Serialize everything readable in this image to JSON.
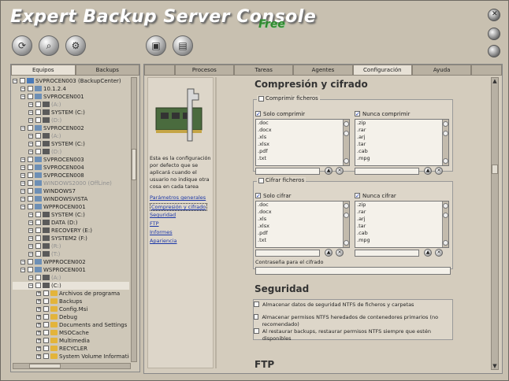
{
  "app": {
    "title": "Expert Backup Server Console",
    "edition": "Free"
  },
  "window_buttons": [
    "close",
    "minimize",
    "restore"
  ],
  "toolbar": {
    "icons": [
      "refresh-icon",
      "search-icon",
      "settings-icon",
      "save-icon",
      "database-icon"
    ]
  },
  "left_panel": {
    "tabs": [
      "Equipos",
      "Backups"
    ],
    "tree": [
      {
        "label": "SVPROCEN003 (BackupCenter)",
        "level": 0
      },
      {
        "label": "10.1.2.4",
        "level": 1
      },
      {
        "label": "SVPROCEN001",
        "level": 1
      },
      {
        "label": "(A:)",
        "level": 2,
        "disabled": true
      },
      {
        "label": "SYSTEM (C:)",
        "level": 2
      },
      {
        "label": "(D:)",
        "level": 2,
        "disabled": true
      },
      {
        "label": "SVPROCEN002",
        "level": 1
      },
      {
        "label": "(A:)",
        "level": 2,
        "disabled": true
      },
      {
        "label": "SYSTEM (C:)",
        "level": 2
      },
      {
        "label": "(D:)",
        "level": 2,
        "disabled": true
      },
      {
        "label": "SVPROCEN003",
        "level": 1
      },
      {
        "label": "SVPROCEN004",
        "level": 1
      },
      {
        "label": "SVPROCEN008",
        "level": 1
      },
      {
        "label": "WINDOWS2000 (OffLine)",
        "level": 1,
        "disabled": true
      },
      {
        "label": "WINDOWS7",
        "level": 1
      },
      {
        "label": "WINDOWSVISTA",
        "level": 1
      },
      {
        "label": "WPPROCEN001",
        "level": 1
      },
      {
        "label": "SYSTEM (C:)",
        "level": 2
      },
      {
        "label": "DATA (D:)",
        "level": 2
      },
      {
        "label": "RECOVERY (E:)",
        "level": 2
      },
      {
        "label": "SYSTEM2 (F:)",
        "level": 2
      },
      {
        "label": "(R:)",
        "level": 2,
        "disabled": true
      },
      {
        "label": "(T:)",
        "level": 2,
        "disabled": true
      },
      {
        "label": "WPPROCEN002",
        "level": 1
      },
      {
        "label": "WSPROCEN001",
        "level": 1
      },
      {
        "label": "(A:)",
        "level": 2,
        "disabled": true
      },
      {
        "label": "(C:)",
        "level": 2,
        "selected": true
      },
      {
        "label": "Archivos de programa",
        "level": 3
      },
      {
        "label": "Backups",
        "level": 3
      },
      {
        "label": "Config.Msi",
        "level": 3
      },
      {
        "label": "Debug",
        "level": 3
      },
      {
        "label": "Documents and Settings",
        "level": 3
      },
      {
        "label": "MSOCache",
        "level": 3
      },
      {
        "label": "Multimedia",
        "level": 3
      },
      {
        "label": "RECYCLER",
        "level": 3
      },
      {
        "label": "System Volume Informatic",
        "level": 3
      }
    ]
  },
  "right_panel": {
    "tabs": [
      "Procesos",
      "Tareas",
      "Agentes",
      "Configuración",
      "Ayuda"
    ],
    "active_tab": "Configuración",
    "info_text": "Esta es la configuración por defecto que se aplicará cuando el usuario no indique otra cosa en cada tarea",
    "links": [
      "Parámetros generales",
      "Compresión y cifrado",
      "Seguridad",
      "FTP",
      "Informes",
      "Apariencia"
    ],
    "compression": {
      "title": "Compresión y cifrado",
      "compress_label": "Comprimir ficheros",
      "only_compress_label": "Solo comprimir",
      "never_compress_label": "Nunca comprimir",
      "only_compress_list": [
        ".doc",
        ".docx",
        ".xls",
        ".xlsx",
        ".pdf",
        ".txt"
      ],
      "never_compress_list": [
        ".zip",
        ".rar",
        ".arj",
        ".tar",
        ".cab",
        ".mpg"
      ]
    },
    "encryption": {
      "encrypt_label": "Cifrar ficheros",
      "only_encrypt_label": "Solo cifrar",
      "never_encrypt_label": "Nunca cifrar",
      "only_encrypt_list": [
        ".doc",
        ".docx",
        ".xls",
        ".xlsx",
        ".pdf",
        ".txt"
      ],
      "never_encrypt_list": [
        ".zip",
        ".rar",
        ".arj",
        ".tar",
        ".cab",
        ".mpg"
      ],
      "password_label": "Contraseña para el cifrado"
    },
    "security": {
      "title": "Seguridad",
      "items": [
        "Almacenar datos de seguridad NTFS de ficheros y carpetas",
        "Almacenar permisos NTFS heredados de contenedores primarios (no recomendado)",
        "Al restaurar backups, restaurar permisos NTFS siempre que estén disponibles"
      ]
    },
    "ftp": {
      "title": "FTP"
    }
  }
}
